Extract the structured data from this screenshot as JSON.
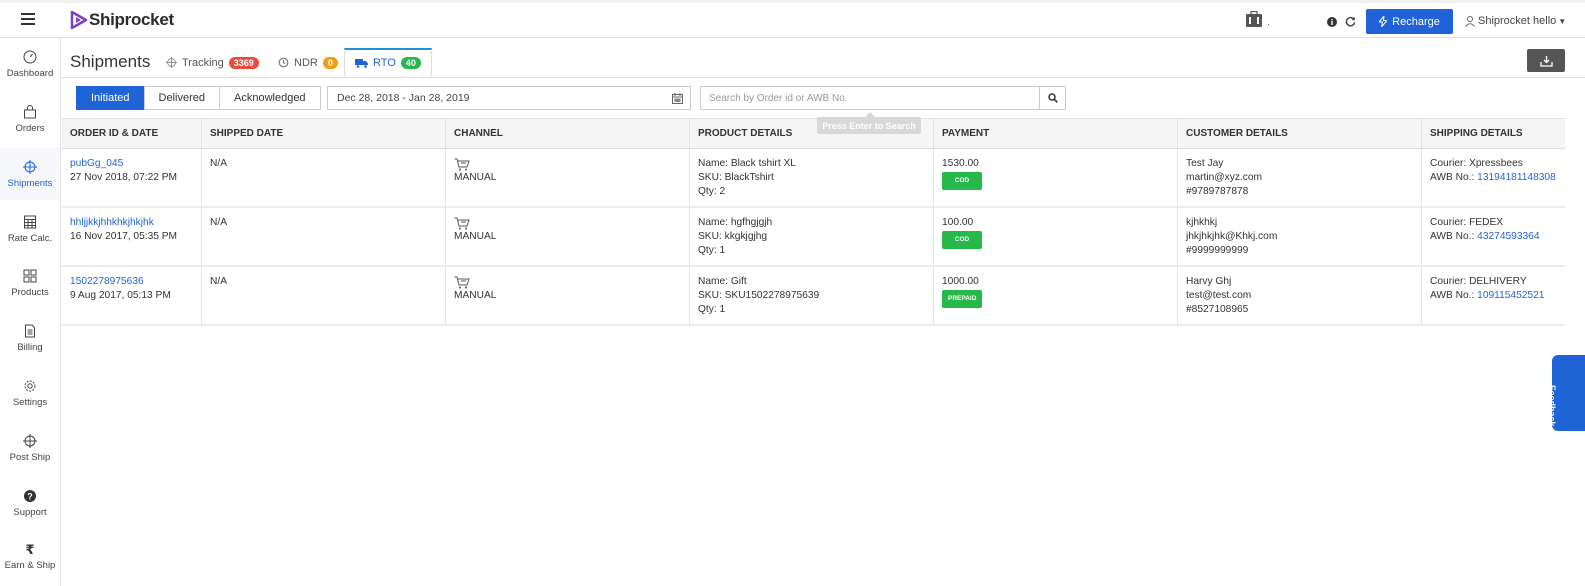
{
  "app": {
    "brand": "Shiprocket",
    "brand_color": "#1f63d6"
  },
  "topbar": {
    "wallet_icon": "wallet-icon",
    "wallet_amount": ".",
    "recharge_label": "Recharge",
    "user_label": "Shiprocket hello"
  },
  "sidebar": {
    "items": [
      {
        "label": "Dashboard",
        "icon": "gauge-icon"
      },
      {
        "label": "Orders",
        "icon": "bag-icon"
      },
      {
        "label": "Shipments",
        "icon": "crosshair-icon",
        "active": true
      },
      {
        "label": "Rate Calc.",
        "icon": "calculator-icon"
      },
      {
        "label": "Products",
        "icon": "grid-icon"
      },
      {
        "label": "Billing",
        "icon": "document-icon"
      },
      {
        "label": "Settings",
        "icon": "gear-icon"
      },
      {
        "label": "Post Ship",
        "icon": "crosshair-icon"
      },
      {
        "label": "Support",
        "icon": "question-icon"
      },
      {
        "label": "Earn & Ship",
        "icon": "rupee-icon"
      }
    ]
  },
  "header": {
    "title": "Shipments",
    "tabs": [
      {
        "label": "Tracking",
        "count": "3369",
        "badge_color": "#e74c3c"
      },
      {
        "label": "NDR",
        "count": "0",
        "badge_color": "#f39c12"
      },
      {
        "label": "RTO",
        "count": "40",
        "badge_color": "#27b84a",
        "active": true
      }
    ]
  },
  "filters": {
    "status_buttons": [
      "Initiated",
      "Delivered",
      "Acknowledged"
    ],
    "active_status": "Initiated",
    "date_range": "Dec 28, 2018 - Jan 28, 2019",
    "search_placeholder": "Search by Order id or AWB No.",
    "search_tooltip": "Press Enter to Search"
  },
  "table": {
    "columns": [
      "ORDER ID & DATE",
      "SHIPPED DATE",
      "CHANNEL",
      "PRODUCT DETAILS",
      "PAYMENT",
      "CUSTOMER DETAILS",
      "SHIPPING DETAILS"
    ],
    "rows": [
      {
        "order_id": "pubGg_045",
        "order_date": "27 Nov 2018, 07:22 PM",
        "shipped_date": "N/A",
        "channel": "MANUAL",
        "product_name": "Name: Black tshirt XL",
        "product_sku": "SKU: BlackTshirt",
        "product_qty": "Qty: 2",
        "amount": "1530.00",
        "payment_method": "COD",
        "customer_name": "Test Jay",
        "customer_email": "martin@xyz.com",
        "customer_phone": "#9789787878",
        "courier": "Courier: Xpressbees",
        "awb_label": "AWB No.: ",
        "awb": "13194181148308"
      },
      {
        "order_id": "hhljjkkjhhkhkjhkjhk",
        "order_date": "16 Nov 2017, 05:35 PM",
        "shipped_date": "N/A",
        "channel": "MANUAL",
        "product_name": "Name: hgfhgjgjh",
        "product_sku": "SKU: kkgkjgjhg",
        "product_qty": "Qty: 1",
        "amount": "100.00",
        "payment_method": "COD",
        "customer_name": "kjhkhkj",
        "customer_email": "jhkjhkjhk@Khkj.com",
        "customer_phone": "#9999999999",
        "courier": "Courier: FEDEX",
        "awb_label": "AWB No.: ",
        "awb": "43274593364"
      },
      {
        "order_id": "1502278975636",
        "order_date": "9 Aug 2017, 05:13 PM",
        "shipped_date": "N/A",
        "channel": "MANUAL",
        "product_name": "Name: Gift",
        "product_sku": "SKU: SKU1502278975639",
        "product_qty": "Qty: 1",
        "amount": "1000.00",
        "payment_method": "PREPAID",
        "customer_name": "Harvy Ghj",
        "customer_email": "test@test.com",
        "customer_phone": "#8527108965",
        "courier": "Courier: DELHIVERY",
        "awb_label": "AWB No.: ",
        "awb": "109115452521"
      }
    ]
  },
  "feedback_label": "Feedback"
}
